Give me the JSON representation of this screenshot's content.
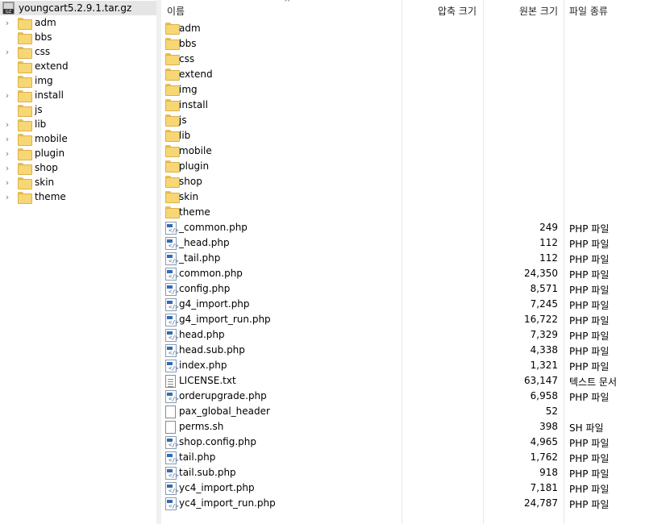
{
  "tree": {
    "root_label": "youngcart5.2.9.1.tar.gz",
    "root_icon": "gz-archive-icon",
    "items": [
      {
        "label": "adm",
        "expandable": true
      },
      {
        "label": "bbs",
        "expandable": false
      },
      {
        "label": "css",
        "expandable": true
      },
      {
        "label": "extend",
        "expandable": false
      },
      {
        "label": "img",
        "expandable": false
      },
      {
        "label": "install",
        "expandable": true
      },
      {
        "label": "js",
        "expandable": false
      },
      {
        "label": "lib",
        "expandable": true
      },
      {
        "label": "mobile",
        "expandable": true
      },
      {
        "label": "plugin",
        "expandable": true
      },
      {
        "label": "shop",
        "expandable": true
      },
      {
        "label": "skin",
        "expandable": true
      },
      {
        "label": "theme",
        "expandable": true
      }
    ]
  },
  "columns": {
    "name": "이름",
    "compressed": "압축 크기",
    "original": "원본 크기",
    "type": "파일 종류"
  },
  "files": [
    {
      "name": "adm",
      "icon": "folder",
      "size": "",
      "type": ""
    },
    {
      "name": "bbs",
      "icon": "folder",
      "size": "",
      "type": ""
    },
    {
      "name": "css",
      "icon": "folder",
      "size": "",
      "type": ""
    },
    {
      "name": "extend",
      "icon": "folder",
      "size": "",
      "type": ""
    },
    {
      "name": "img",
      "icon": "folder",
      "size": "",
      "type": ""
    },
    {
      "name": "install",
      "icon": "folder",
      "size": "",
      "type": ""
    },
    {
      "name": "js",
      "icon": "folder",
      "size": "",
      "type": ""
    },
    {
      "name": "lib",
      "icon": "folder",
      "size": "",
      "type": ""
    },
    {
      "name": "mobile",
      "icon": "folder",
      "size": "",
      "type": ""
    },
    {
      "name": "plugin",
      "icon": "folder",
      "size": "",
      "type": ""
    },
    {
      "name": "shop",
      "icon": "folder",
      "size": "",
      "type": ""
    },
    {
      "name": "skin",
      "icon": "folder",
      "size": "",
      "type": ""
    },
    {
      "name": "theme",
      "icon": "folder",
      "size": "",
      "type": ""
    },
    {
      "name": "_common.php",
      "icon": "php",
      "size": "249",
      "type": "PHP 파일"
    },
    {
      "name": "_head.php",
      "icon": "php",
      "size": "112",
      "type": "PHP 파일"
    },
    {
      "name": "_tail.php",
      "icon": "php",
      "size": "112",
      "type": "PHP 파일"
    },
    {
      "name": "common.php",
      "icon": "php",
      "size": "24,350",
      "type": "PHP 파일"
    },
    {
      "name": "config.php",
      "icon": "php",
      "size": "8,571",
      "type": "PHP 파일"
    },
    {
      "name": "g4_import.php",
      "icon": "php",
      "size": "7,245",
      "type": "PHP 파일"
    },
    {
      "name": "g4_import_run.php",
      "icon": "php",
      "size": "16,722",
      "type": "PHP 파일"
    },
    {
      "name": "head.php",
      "icon": "php",
      "size": "7,329",
      "type": "PHP 파일"
    },
    {
      "name": "head.sub.php",
      "icon": "php",
      "size": "4,338",
      "type": "PHP 파일"
    },
    {
      "name": "index.php",
      "icon": "php",
      "size": "1,321",
      "type": "PHP 파일"
    },
    {
      "name": "LICENSE.txt",
      "icon": "txt",
      "size": "63,147",
      "type": "텍스트 문서"
    },
    {
      "name": "orderupgrade.php",
      "icon": "php",
      "size": "6,958",
      "type": "PHP 파일"
    },
    {
      "name": "pax_global_header",
      "icon": "blank",
      "size": "52",
      "type": ""
    },
    {
      "name": "perms.sh",
      "icon": "blank",
      "size": "398",
      "type": "SH 파일"
    },
    {
      "name": "shop.config.php",
      "icon": "php",
      "size": "4,965",
      "type": "PHP 파일"
    },
    {
      "name": "tail.php",
      "icon": "php",
      "size": "1,762",
      "type": "PHP 파일"
    },
    {
      "name": "tail.sub.php",
      "icon": "php",
      "size": "918",
      "type": "PHP 파일"
    },
    {
      "name": "yc4_import.php",
      "icon": "php",
      "size": "7,181",
      "type": "PHP 파일"
    },
    {
      "name": "yc4_import_run.php",
      "icon": "php",
      "size": "24,787",
      "type": "PHP 파일"
    }
  ]
}
